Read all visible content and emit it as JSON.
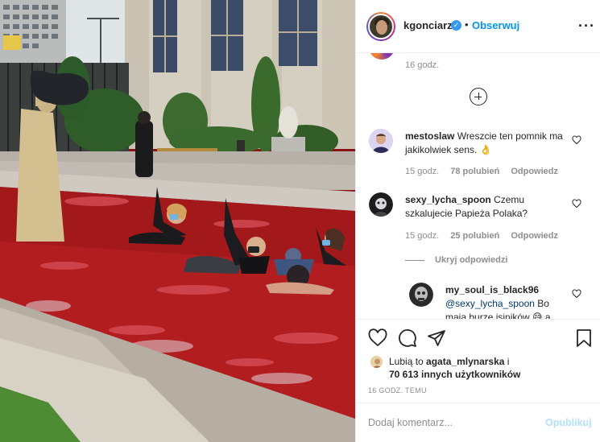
{
  "header": {
    "username": "kgonciarz",
    "verified": true,
    "separator": "•",
    "follow_label": "Obserwuj",
    "more_icon": "more-horizontal-icon"
  },
  "previous_comment": {
    "time": "16 godz."
  },
  "comments": [
    {
      "author": "mestoslaw",
      "text": "Wreszcie ten pomnik ma jakikolwiek sens. 👌",
      "time": "15 godz.",
      "likes": "78 polubień",
      "reply": "Odpowiedz"
    },
    {
      "author": "sexy_lycha_spoon",
      "text": "Czemu szkalujecie Papieża Polaka?",
      "time": "15 godz.",
      "likes": "25 polubień",
      "reply": "Odpowiedz"
    }
  ],
  "hide_replies_label": "Ukryj odpowiedzi",
  "reply": {
    "author": "my_soul_is_black96",
    "mention": "@sexy_lycha_spoon",
    "text": "Bo mają burze jsiników 😅 a"
  },
  "likes": {
    "line1_prefix": "Lubią to",
    "line1_user": "agata_mlynarska",
    "line1_suffix": "i",
    "line2": "70 613 innych użytkowników"
  },
  "post_time": "16 GODZ. TEMU",
  "comment_box": {
    "placeholder": "Dodaj komentarz...",
    "publish_label": "Opublikuj"
  },
  "colors": {
    "link_blue": "#0095f6",
    "publish_disabled": "#b2dffc",
    "muted": "#8e8e8e",
    "water_red": "#a3181a"
  }
}
